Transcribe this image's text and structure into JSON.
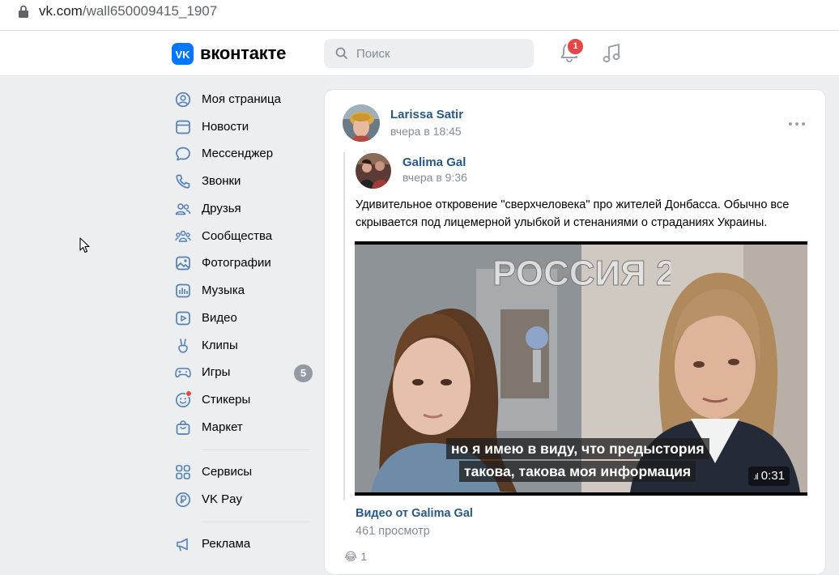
{
  "browser": {
    "url_host": "vk.com",
    "url_path": "/wall650009415_1907"
  },
  "header": {
    "logo_text": "вконтакте",
    "search_placeholder": "Поиск",
    "notifications_count": "1"
  },
  "nav": {
    "items": [
      {
        "label": "Моя страница",
        "icon": "user-circle-icon"
      },
      {
        "label": "Новости",
        "icon": "newsfeed-icon"
      },
      {
        "label": "Мессенджер",
        "icon": "message-icon"
      },
      {
        "label": "Звонки",
        "icon": "phone-icon"
      },
      {
        "label": "Друзья",
        "icon": "friends-icon"
      },
      {
        "label": "Сообщества",
        "icon": "communities-icon"
      },
      {
        "label": "Фотографии",
        "icon": "photo-icon"
      },
      {
        "label": "Музыка",
        "icon": "music-icon"
      },
      {
        "label": "Видео",
        "icon": "video-icon"
      },
      {
        "label": "Клипы",
        "icon": "clips-icon"
      },
      {
        "label": "Игры",
        "icon": "gamepad-icon",
        "count": "5"
      },
      {
        "label": "Стикеры",
        "icon": "sticker-icon"
      },
      {
        "label": "Маркет",
        "icon": "bag-icon"
      },
      {
        "label": "Сервисы",
        "icon": "services-icon"
      },
      {
        "label": "VK Pay",
        "icon": "vkpay-icon"
      },
      {
        "label": "Реклама",
        "icon": "megaphone-icon"
      }
    ]
  },
  "post": {
    "author": "Larissa Satir",
    "time": "вчера в 18:45",
    "repost": {
      "author": "Galima Gal",
      "time": "вчера в 9:36",
      "text": "Удивительное откровение \"сверхчеловека\" про жителей Донбасса. Обычно все скрывается под лицемерной улыбкой и стенаниями о страданиях Украины.",
      "video": {
        "overlay_logo": "РОССИЯ 2.0",
        "subtitle_line1": "но я имею в виду, что предыстория",
        "subtitle_line2": "такова, такова моя информация",
        "duration": "0:31",
        "title": "Видео от Galima Gal",
        "views": "461 просмотр"
      }
    },
    "reactions_count": "1"
  },
  "colors": {
    "vk_blue": "#0077ff",
    "link": "#2a5885",
    "muted": "#818c99",
    "badge_red": "#e64646"
  }
}
